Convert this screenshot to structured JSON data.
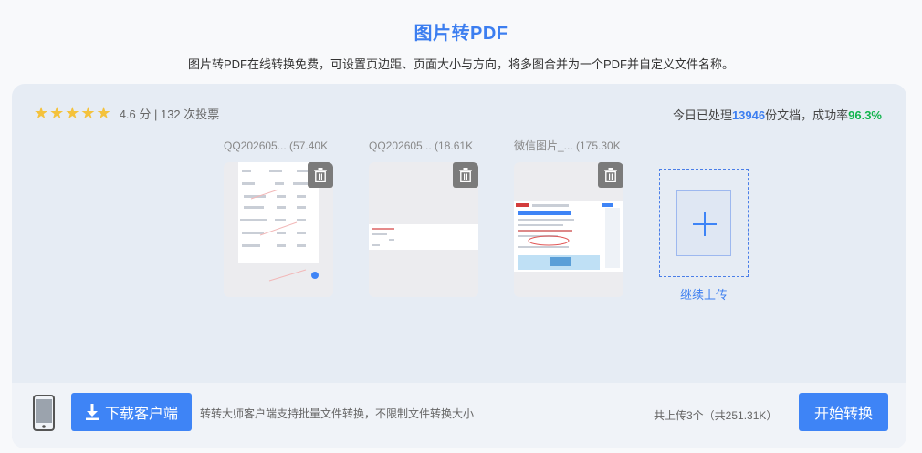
{
  "header": {
    "title": "图片转PDF",
    "subtitle": "图片转PDF在线转换免费，可设置页边距、页面大小与方向，将多图合并为一个PDF并自定义文件名称。"
  },
  "rating": {
    "stars": "★★★★★",
    "score_text": "4.6 分 | 132 次投票"
  },
  "stats": {
    "prefix": "今日已处理",
    "count": "13946",
    "middle": "份文档，成功率",
    "rate": "96.3%"
  },
  "files": [
    {
      "name": "QQ202605... (57.40K",
      "icon": "trash-icon"
    },
    {
      "name": "QQ202605... (18.61K",
      "icon": "trash-icon"
    },
    {
      "name": "微信图片_... (175.30K",
      "icon": "trash-icon"
    }
  ],
  "upload": {
    "continue_label": "继续上传",
    "icon": "plus-icon"
  },
  "footer": {
    "download_label": "下载客户端",
    "client_note": "转转大师客户端支持批量文件转换，不限制文件转换大小",
    "total_text": "共上传3个（共251.31K）",
    "start_label": "开始转换"
  },
  "colors": {
    "accent": "#3e84f6",
    "title_blue": "#3c7ef0",
    "success_green": "#12b44d",
    "star_yellow": "#f4c23c",
    "panel_bg": "#e6ecf4"
  }
}
